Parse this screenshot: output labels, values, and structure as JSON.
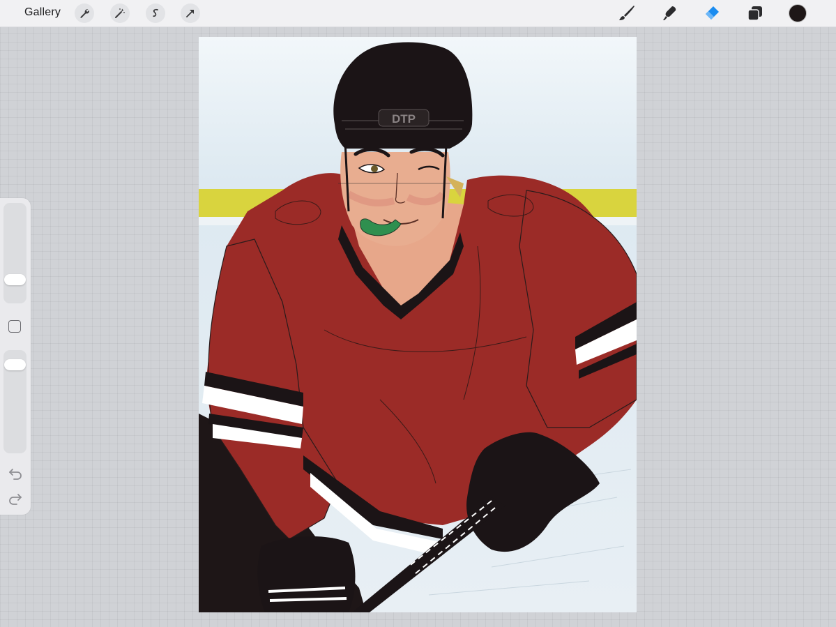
{
  "toolbar": {
    "gallery_label": "Gallery",
    "left_tools": [
      "wrench-icon",
      "magic-wand-icon",
      "selection-icon",
      "transform-arrow-icon"
    ],
    "right_tools": [
      "brush-icon",
      "smudge-icon",
      "eraser-icon",
      "layers-icon"
    ],
    "active_tool": "eraser",
    "current_color": "#1e1717",
    "accent_color": "#1a8cf0"
  },
  "sidebar": {
    "brush_size": 0.2,
    "brush_opacity": 0.9
  },
  "canvas": {
    "artwork": "hockey-player-illustration",
    "helmet_text": "DTP",
    "colors": {
      "jersey": "#9b2b27",
      "helmet": "#1b1416",
      "ice": "#eaf1f5",
      "rink_stripe": "#d8d12a",
      "mouthguard": "#2f8f4f"
    }
  }
}
